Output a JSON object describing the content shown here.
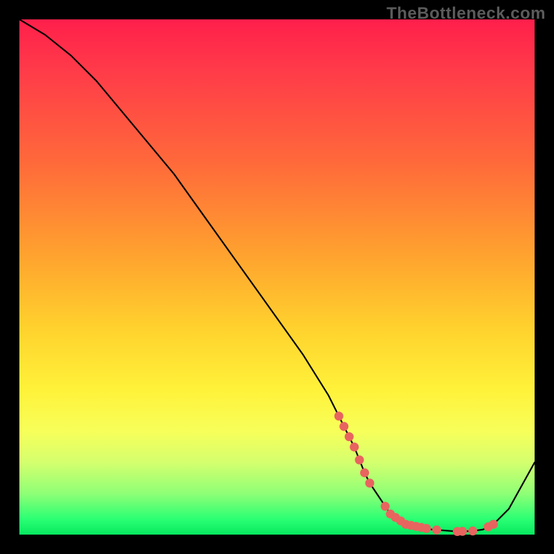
{
  "watermark": "TheBottleneck.com",
  "colors": {
    "background": "#000000",
    "curve": "#000000",
    "dots": "#e8645f",
    "gradient_stops": [
      "#ff1f4b",
      "#ff6a3a",
      "#ffd22d",
      "#fff23a",
      "#8fff76",
      "#07e860"
    ]
  },
  "chart_data": {
    "type": "line",
    "title": "",
    "xlabel": "",
    "ylabel": "",
    "xlim": [
      0,
      100
    ],
    "ylim": [
      0,
      100
    ],
    "x": [
      0,
      5,
      10,
      15,
      20,
      25,
      30,
      35,
      40,
      45,
      50,
      55,
      60,
      62,
      65,
      67,
      68,
      70,
      72,
      75,
      80,
      85,
      88,
      90,
      92,
      95,
      100
    ],
    "values": [
      100,
      97,
      93,
      88,
      82,
      76,
      70,
      63,
      56,
      49,
      42,
      35,
      27,
      23,
      17,
      12,
      10,
      7,
      4,
      2,
      1,
      0.6,
      0.7,
      1,
      2,
      5,
      14
    ],
    "annotations": {
      "highlighted_x_range": [
        62,
        92
      ],
      "highlighted_points_x": [
        62,
        63,
        64,
        65,
        66,
        67,
        68,
        71,
        72,
        73,
        74,
        75,
        76,
        77,
        78,
        79,
        81,
        85,
        86,
        88,
        91,
        92
      ]
    }
  }
}
